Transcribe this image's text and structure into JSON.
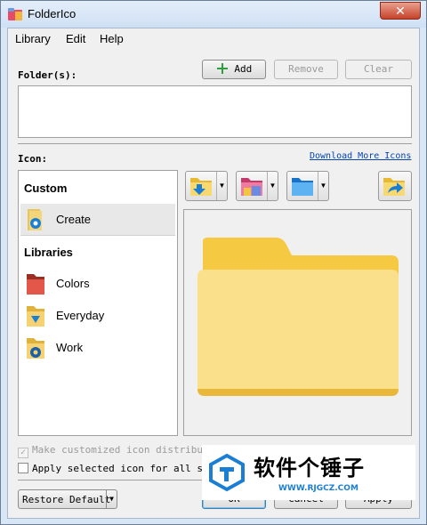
{
  "window": {
    "title": "FolderIco",
    "close_glyph": "✕"
  },
  "menu": [
    "Library",
    "Edit",
    "Help"
  ],
  "folder_section": {
    "label": "Folder(s):",
    "add_label": "Add",
    "remove_label": "Remove",
    "clear_label": "Clear"
  },
  "icon_section": {
    "label": "Icon:",
    "download_link": "Download More Icons"
  },
  "library": {
    "custom_header": "Custom",
    "custom_items": [
      {
        "label": "Create",
        "icon": "create-gear-folder-icon",
        "selected": true
      }
    ],
    "libraries_header": "Libraries",
    "library_items": [
      {
        "label": "Colors",
        "icon": "colors-folder-icon"
      },
      {
        "label": "Everyday",
        "icon": "everyday-folder-icon"
      },
      {
        "label": "Work",
        "icon": "work-folder-icon"
      }
    ]
  },
  "options": {
    "make_customized": {
      "label": "Make customized icon distributab",
      "checked": true,
      "disabled": true
    },
    "apply_to_all": {
      "label": "Apply selected icon for all sub",
      "checked": false,
      "disabled": false
    }
  },
  "footer": {
    "restore_value": "Restore Default",
    "ok_label": "OK",
    "cancel_label": "Cancel",
    "apply_label": "Apply"
  },
  "watermark": {
    "brand": "软件个锤子",
    "url": "WWW.RJGCZ.COM"
  },
  "colors": {
    "folder_yellow": "#f6c943",
    "folder_light": "#fbe08c",
    "accent_blue": "#1a7fd4",
    "link": "#0645ad"
  }
}
